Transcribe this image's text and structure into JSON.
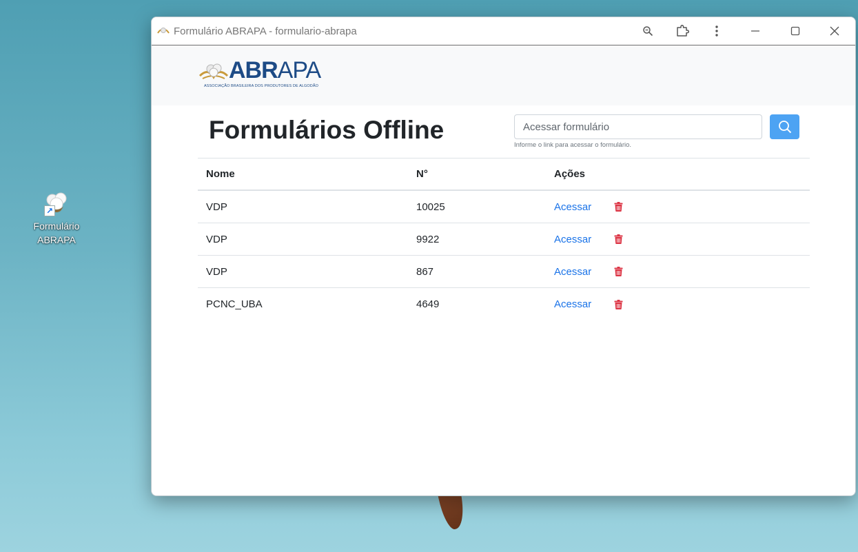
{
  "desktop": {
    "shortcut_label": "Formulário ABRAPA"
  },
  "window": {
    "title": "Formulário ABRAPA - formulario-abrapa"
  },
  "brand": {
    "logo_bold": "ABR",
    "logo_light": "APA",
    "tagline": "ASSOCIAÇÃO BRASILEIRA DOS PRODUTORES DE ALGODÃO",
    "color": "#1d4b86",
    "accent": "#c99a3a"
  },
  "page": {
    "title": "Formulários Offline"
  },
  "search": {
    "placeholder": "Acessar formulário",
    "help": "Informe o link para acessar o formulário.",
    "button_color": "#4da3f3"
  },
  "table": {
    "headers": [
      "Nome",
      "N°",
      "Ações"
    ],
    "rows": [
      {
        "name": "VDP",
        "number": "10025",
        "action": "Acessar"
      },
      {
        "name": "VDP",
        "number": "9922",
        "action": "Acessar"
      },
      {
        "name": "VDP",
        "number": "867",
        "action": "Acessar"
      },
      {
        "name": "PCNC_UBA",
        "number": "4649",
        "action": "Acessar"
      }
    ],
    "link_color": "#1a73e8",
    "delete_color": "#dc3545"
  }
}
